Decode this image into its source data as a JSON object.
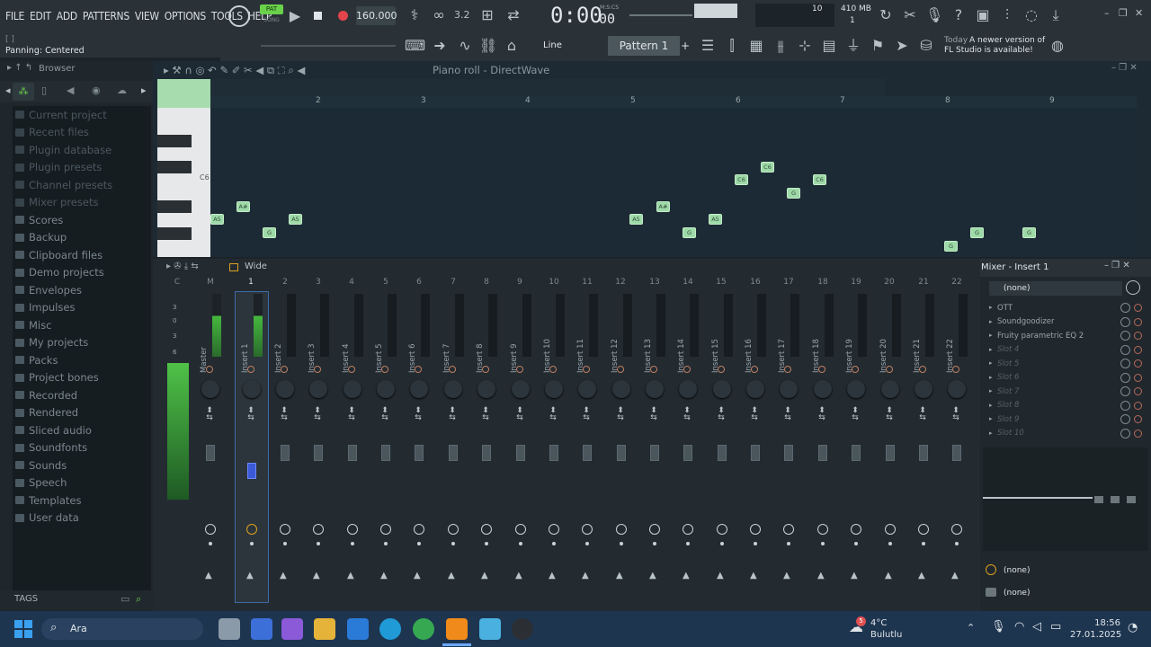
{
  "menu": [
    "FILE",
    "EDIT",
    "ADD",
    "PATTERNS",
    "VIEW",
    "OPTIONS",
    "TOOLS",
    "HELP"
  ],
  "transport": {
    "pat_label": "PAT",
    "song_label": "SONG",
    "tempo": "160.000",
    "time": "0:00",
    "time_small": "00",
    "time_unit": "M:S:CS"
  },
  "cpu": {
    "poly": "10",
    "memory": "410 MB",
    "voices": "1"
  },
  "hint": {
    "brackets": "[   ]",
    "text": "Panning: Centered"
  },
  "toolbar2": {
    "snap": "Line",
    "pattern": "Pattern 1"
  },
  "news": {
    "line1": "Today",
    "line1b": "A newer version of",
    "line2": "FL Studio is available!"
  },
  "browser": {
    "title": "Browser",
    "items": [
      "Current project",
      "Recent files",
      "Plugin database",
      "Plugin presets",
      "Channel presets",
      "Mixer presets",
      "Scores",
      "Backup",
      "Clipboard files",
      "Demo projects",
      "Envelopes",
      "Impulses",
      "Misc",
      "My projects",
      "Packs",
      "Project bones",
      "Recorded",
      "Rendered",
      "Sliced audio",
      "Soundfonts",
      "Sounds",
      "Speech",
      "Templates",
      "User data"
    ],
    "tags": "TAGS"
  },
  "piano_roll": {
    "title": "Piano roll - DirectWave",
    "bars": [
      "2",
      "3",
      "4",
      "5",
      "6",
      "7",
      "8",
      "9"
    ],
    "key_label": "C6",
    "notes": [
      "A5",
      "A#",
      "G",
      "A5",
      "A5",
      "A#",
      "G",
      "A5",
      "C6",
      "C6",
      "G",
      "C6",
      "G",
      "G",
      "G"
    ]
  },
  "mixer": {
    "toolbar_label": "Wide",
    "track_numbers": [
      "C",
      "M",
      "1",
      "2",
      "3",
      "4",
      "5",
      "6",
      "7",
      "8",
      "9",
      "10",
      "11",
      "12",
      "13",
      "14",
      "15",
      "16",
      "17",
      "18",
      "19",
      "20",
      "21",
      "22"
    ],
    "master_scale": [
      "3",
      "0",
      "3",
      "6"
    ],
    "tracks": [
      "Master",
      "Insert 1",
      "Insert 2",
      "Insert 3",
      "Insert 4",
      "Insert 5",
      "Insert 6",
      "Insert 7",
      "Insert 8",
      "Insert 9",
      "Insert 10",
      "Insert 11",
      "Insert 12",
      "Insert 13",
      "Insert 14",
      "Insert 15",
      "Insert 16",
      "Insert 17",
      "Insert 18",
      "Insert 19",
      "Insert 20",
      "Insert 21",
      "Insert 22"
    ]
  },
  "insert_panel": {
    "title": "Mixer - Insert 1",
    "input": "(none)",
    "slots": [
      "OTT",
      "Soundgoodizer",
      "Fruity parametric EQ 2",
      "Slot 4",
      "Slot 5",
      "Slot 6",
      "Slot 7",
      "Slot 8",
      "Slot 9",
      "Slot 10"
    ],
    "out1": "(none)",
    "out2": "(none)"
  },
  "taskbar": {
    "search": "Ara",
    "weather_temp": "4°C",
    "weather_desc": "Bulutlu",
    "badge": "5",
    "time": "18:56",
    "date": "27.01.2025"
  },
  "colors": {
    "accent_green": "#9ed9a8",
    "panel": "#2a3238",
    "background": "#1c2329"
  }
}
